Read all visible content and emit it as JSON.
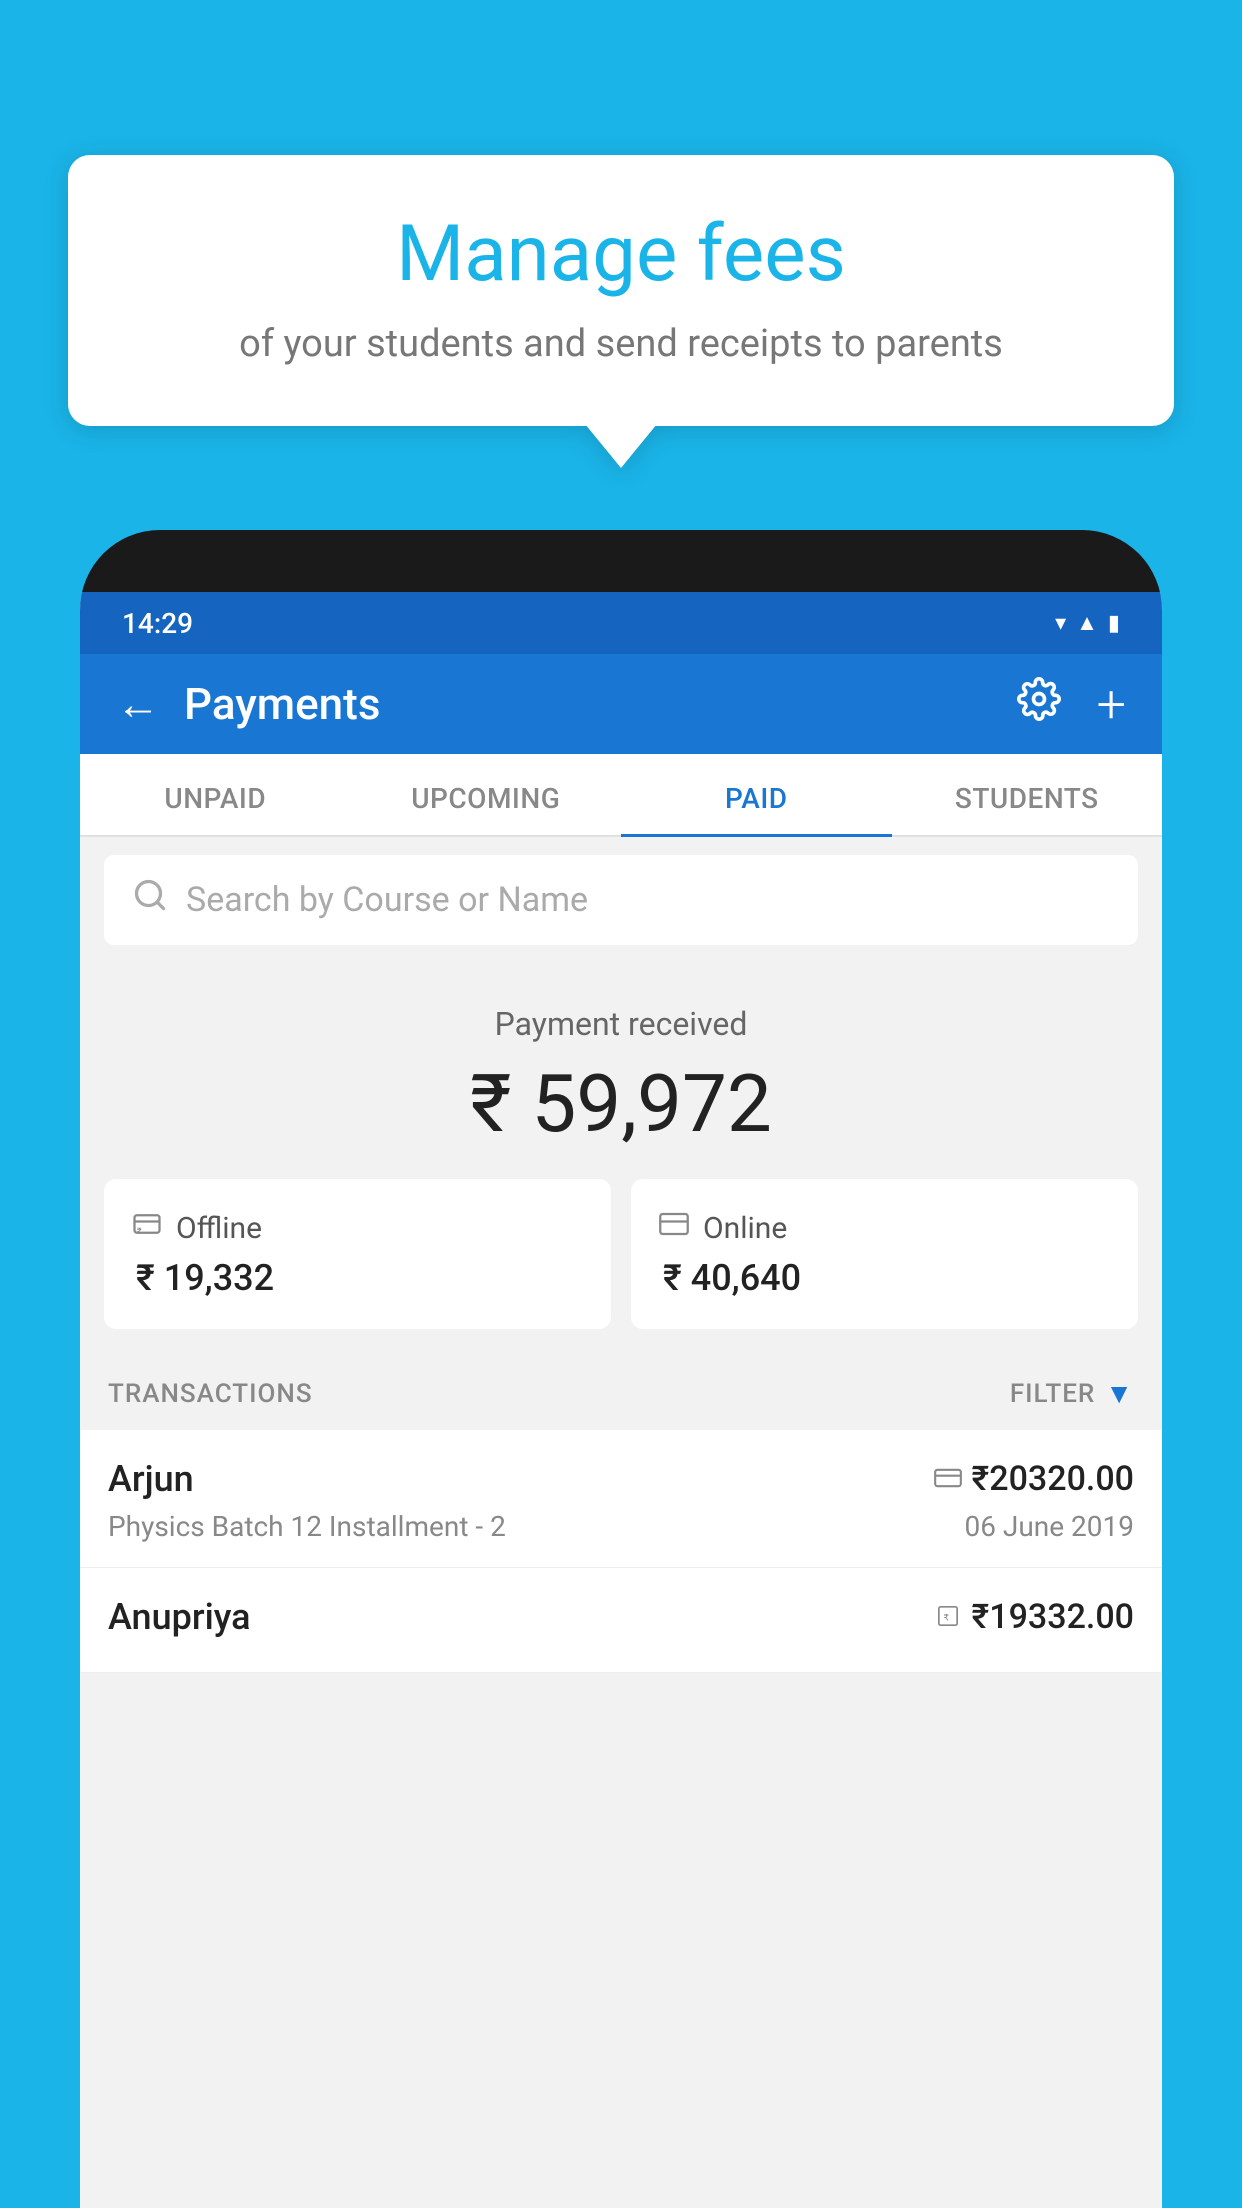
{
  "background_color": "#1ab4e8",
  "bubble": {
    "title": "Manage fees",
    "subtitle": "of your students and send receipts to parents"
  },
  "status_bar": {
    "time": "14:29",
    "icons": [
      "wifi",
      "signal",
      "battery"
    ]
  },
  "header": {
    "title": "Payments",
    "back_label": "←",
    "settings_icon": "gear",
    "add_icon": "+"
  },
  "tabs": [
    {
      "label": "UNPAID",
      "active": false
    },
    {
      "label": "UPCOMING",
      "active": false
    },
    {
      "label": "PAID",
      "active": true
    },
    {
      "label": "STUDENTS",
      "active": false
    }
  ],
  "search": {
    "placeholder": "Search by Course or Name"
  },
  "payment_received": {
    "label": "Payment received",
    "amount": "₹ 59,972",
    "offline": {
      "label": "Offline",
      "amount": "₹ 19,332",
      "icon": "₹-box"
    },
    "online": {
      "label": "Online",
      "amount": "₹ 40,640",
      "icon": "card"
    }
  },
  "transactions": {
    "section_label": "TRANSACTIONS",
    "filter_label": "FILTER",
    "rows": [
      {
        "name": "Arjun",
        "course": "Physics Batch 12 Installment - 2",
        "amount": "₹20320.00",
        "date": "06 June 2019",
        "payment_type": "card"
      },
      {
        "name": "Anupriya",
        "course": "",
        "amount": "₹19332.00",
        "date": "",
        "payment_type": "rupee-box"
      }
    ]
  }
}
